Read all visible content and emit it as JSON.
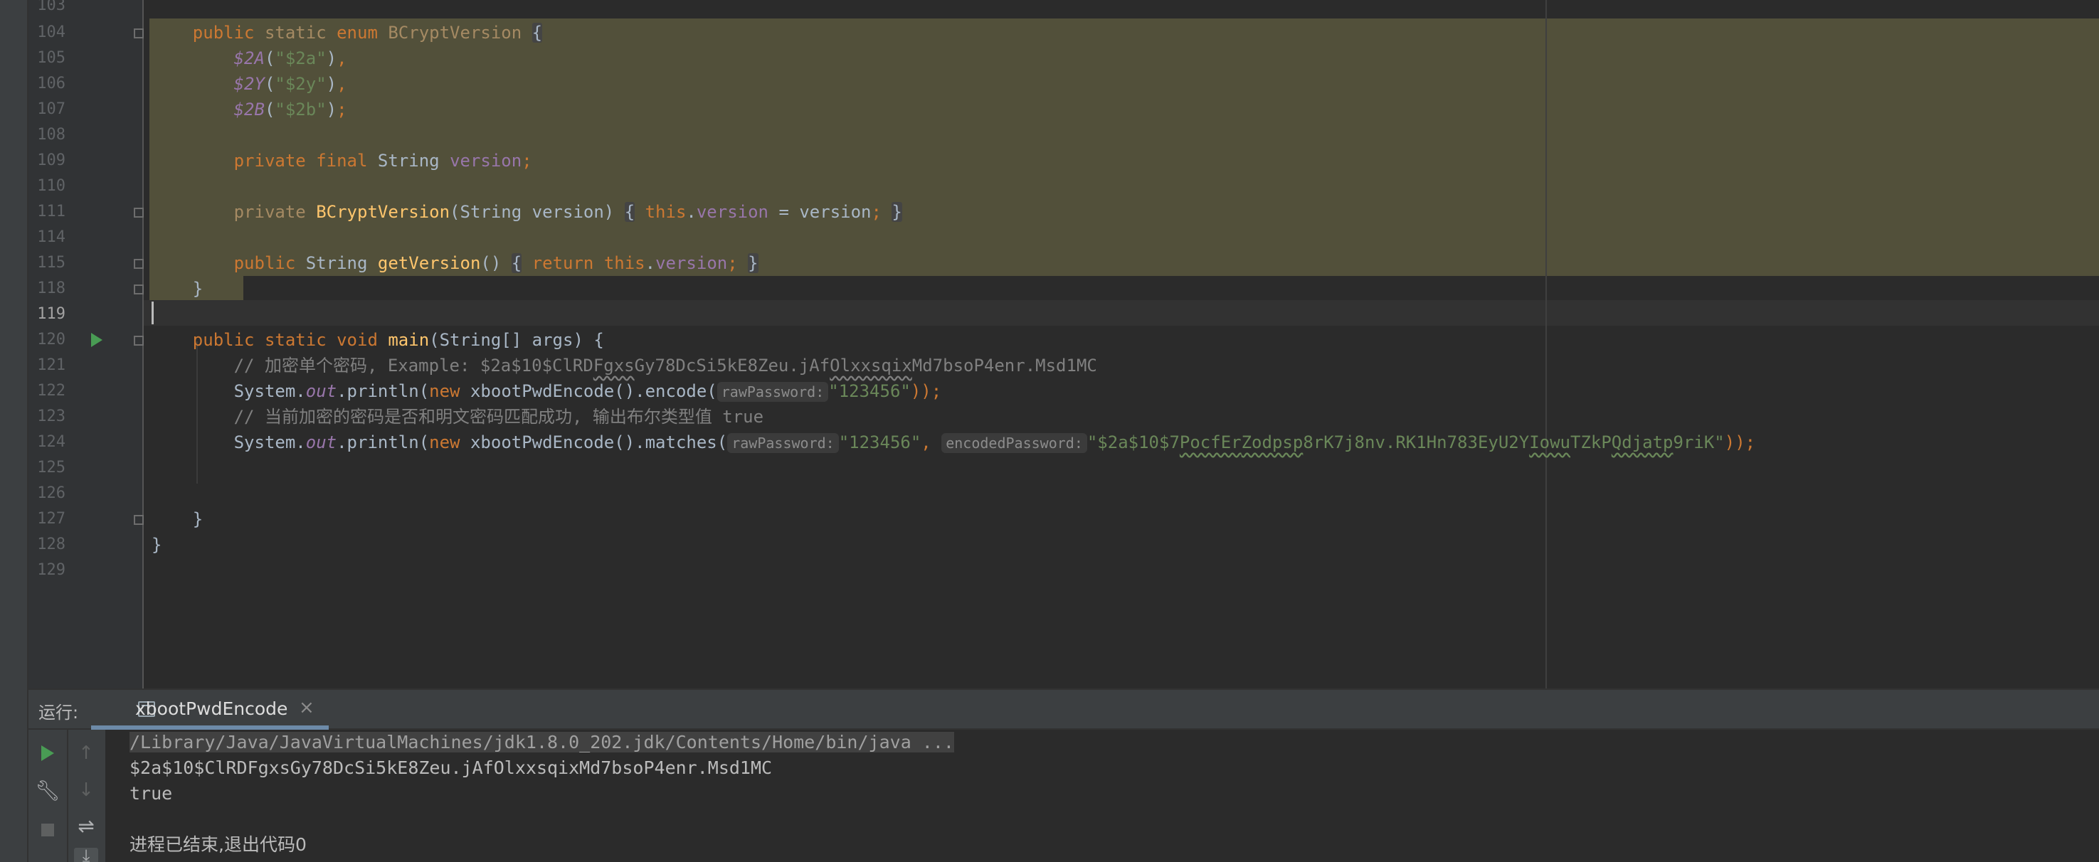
{
  "editor": {
    "line_numbers": [
      "103",
      "104",
      "105",
      "106",
      "107",
      "108",
      "109",
      "110",
      "111",
      "114",
      "115",
      "118",
      "119",
      "120",
      "121",
      "122",
      "123",
      "124",
      "125",
      "126",
      "127",
      "128",
      "129"
    ],
    "current_line": "119",
    "code": {
      "l104": {
        "indent": "    ",
        "kw1": "public",
        "kw2": "static",
        "kw3": "enum",
        "name": "BCryptVersion",
        "brace": "{"
      },
      "l105": {
        "indent": "        ",
        "const": "$2A",
        "open": "(",
        "str": "\"$2a\"",
        "close": ")",
        "end": ","
      },
      "l106": {
        "indent": "        ",
        "const": "$2Y",
        "open": "(",
        "str": "\"$2y\"",
        "close": ")",
        "end": ","
      },
      "l107": {
        "indent": "        ",
        "const": "$2B",
        "open": "(",
        "str": "\"$2b\"",
        "close": ")",
        "end": ";"
      },
      "l109": {
        "indent": "        ",
        "kw1": "private",
        "kw2": "final",
        "type": "String",
        "field": "version",
        "end": ";"
      },
      "l111": {
        "indent": "        ",
        "kw": "private",
        "name": "BCryptVersion",
        "params": "(String version)",
        "b1": "{",
        "kw_this": "this",
        "dot": ".",
        "field": "version",
        "assign": " = version",
        "semi": ";",
        "b2": "}"
      },
      "l115": {
        "indent": "        ",
        "kw": "public",
        "type": "String",
        "name": "getVersion",
        "params": "()",
        "b1": "{",
        "kw_ret": "return",
        "kw_this": "this",
        "dot": ".",
        "field": "version",
        "semi": ";",
        "b2": "}"
      },
      "l118": {
        "indent": "    ",
        "brace": "}"
      },
      "l120": {
        "indent": "    ",
        "kw1": "public",
        "kw2": "static",
        "kw3": "void",
        "name": "main",
        "params": "(String[] args) {"
      },
      "l121": {
        "indent": "        ",
        "comment_a": "// 加密单个密码, Example: $2a$10$ClRD",
        "comment_b": "Fgxs",
        "comment_c": "Gy78DcSi5kE8Zeu.jAf",
        "comment_d": "Olxxsqix",
        "comment_e": "Md7bsoP4enr.Msd1MC"
      },
      "l122": {
        "indent": "        ",
        "sys": "System.",
        "out": "out",
        "println": ".println(",
        "kw_new": "new",
        "call": " xbootPwdEncode().encode(",
        "hint": "rawPassword:",
        "str": "\"123456\"",
        "end": "));"
      },
      "l123": {
        "indent": "        ",
        "comment": "// 当前加密的密码是否和明文密码匹配成功, 输出布尔类型值 true"
      },
      "l124": {
        "indent": "        ",
        "sys": "System.",
        "out": "out",
        "println": ".println(",
        "kw_new": "new",
        "call": " xbootPwdEncode().matches(",
        "hint1": "rawPassword:",
        "str1": "\"123456\"",
        "comma": ", ",
        "hint2": "encodedPassword:",
        "str2a": "\"$2a$10$7",
        "str2b": "PocfEr",
        "str2c": "Zodpsp",
        "str2d": "8rK7j8nv.RK1Hn783EyU2Y",
        "str2e": "Iowu",
        "str2f": "TZkP",
        "str2g": "Qdjatp",
        "str2h": "9riK\"",
        "end": "));"
      },
      "l127": {
        "indent": "    ",
        "brace": "}"
      },
      "l128": {
        "indent": "",
        "brace": "}"
      }
    }
  },
  "run_panel": {
    "label": "运行:",
    "tab_label": "xbootPwdEncode",
    "tab_close": "×",
    "icons": [
      "rerun-icon",
      "wrench-icon",
      "stop-icon",
      "up-arrow-icon",
      "down-arrow-icon",
      "soft-wrap-icon",
      "scroll-to-end-icon"
    ],
    "console": {
      "cmd": "/Library/Java/JavaVirtualMachines/jdk1.8.0_202.jdk/Contents/Home/bin/java ...",
      "out1": "$2a$10$ClRDFgxsGy78DcSi5kE8Zeu.jAfOlxxsqixMd7bsoP4enr.Msd1MC",
      "out2": "true",
      "exit": "进程已结束,退出代码0"
    }
  }
}
